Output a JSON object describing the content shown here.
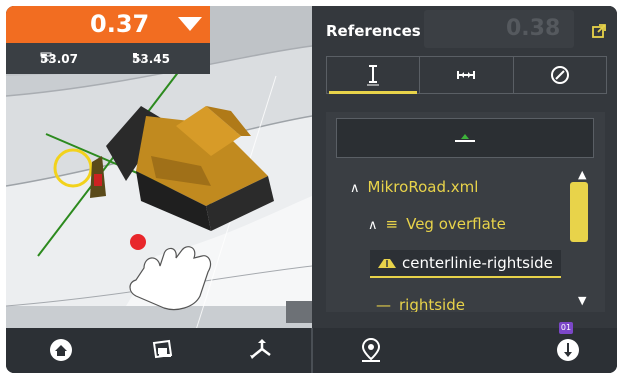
{
  "readout": {
    "value": "0.37",
    "left_value": "53.07",
    "right_value": "53.45",
    "color": "#f26d21"
  },
  "panel": {
    "title": "References",
    "ghost_value": "0.38",
    "tabs": [
      {
        "icon": "vertical-offset-icon",
        "active": true
      },
      {
        "icon": "horizontal-offset-icon",
        "active": false
      },
      {
        "icon": "compass-icon",
        "active": false
      }
    ],
    "surface_button_icon": "surface-icon",
    "tree": [
      {
        "label": "MikroRoad.xml",
        "expanded": true,
        "level": 0
      },
      {
        "label": "Veg overflate",
        "expanded": true,
        "level": 1,
        "icon": "layers-icon"
      },
      {
        "label": "centerlinie-rightside",
        "selected": true,
        "level": 2,
        "icon": "road-surface-icon"
      },
      {
        "label": "rightside",
        "level": 2,
        "icon": "line-icon"
      }
    ],
    "accent": "#e8d34a"
  },
  "toolbar": {
    "buttons": [
      "home-icon",
      "machine-view-icon",
      "axes-icon",
      "location-pin-icon",
      "depth-probe-icon"
    ],
    "badge": "01"
  }
}
